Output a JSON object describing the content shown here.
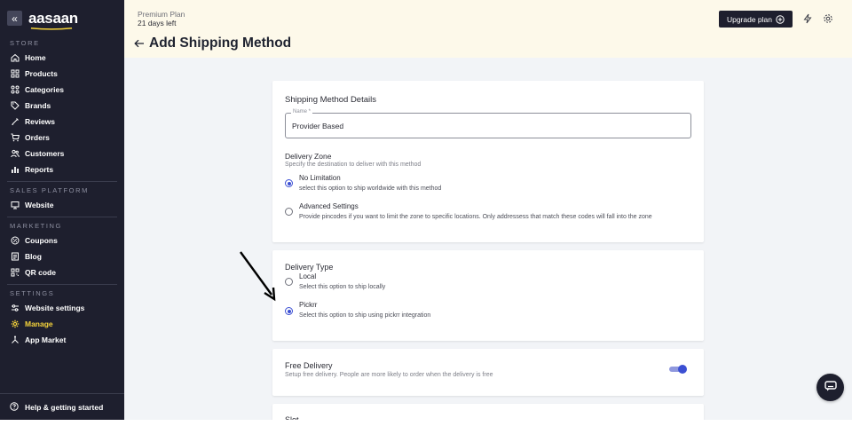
{
  "brand": {
    "logo_text": "aasaan",
    "accent_color": "#f5d33b",
    "primary_color": "#3b4fd3",
    "sidebar_bg": "#1e1f2e"
  },
  "sidebar": {
    "collapse_glyph": "«",
    "sections": [
      {
        "label": "STORE",
        "items": [
          {
            "label": "Home",
            "icon": "home-icon"
          },
          {
            "label": "Products",
            "icon": "grid-icon"
          },
          {
            "label": "Categories",
            "icon": "categories-icon"
          },
          {
            "label": "Brands",
            "icon": "tag-icon"
          },
          {
            "label": "Reviews",
            "icon": "star-pen-icon"
          },
          {
            "label": "Orders",
            "icon": "cart-icon"
          },
          {
            "label": "Customers",
            "icon": "users-icon"
          },
          {
            "label": "Reports",
            "icon": "bar-chart-icon"
          }
        ]
      },
      {
        "label": "SALES PLATFORM",
        "items": [
          {
            "label": "Website",
            "icon": "monitor-icon"
          }
        ]
      },
      {
        "label": "MARKETING",
        "items": [
          {
            "label": "Coupons",
            "icon": "coupon-icon"
          },
          {
            "label": "Blog",
            "icon": "blog-icon"
          },
          {
            "label": "QR code",
            "icon": "qr-code-icon"
          }
        ]
      },
      {
        "label": "SETTINGS",
        "items": [
          {
            "label": "Website settings",
            "icon": "sliders-icon"
          },
          {
            "label": "Manage",
            "icon": "gear-icon",
            "active": true
          },
          {
            "label": "App Market",
            "icon": "app-market-icon"
          }
        ]
      }
    ],
    "help_label": "Help & getting started"
  },
  "header": {
    "plan_name": "Premium Plan",
    "plan_days": "21 days left",
    "page_title": "Add Shipping Method",
    "upgrade_label": "Upgrade plan"
  },
  "details_card": {
    "title": "Shipping Method Details",
    "name_field": {
      "label": "Name *",
      "value": "Provider Based"
    },
    "delivery_zone": {
      "title": "Delivery Zone",
      "subtitle": "Specify the destination to deliver with this method",
      "options": [
        {
          "title": "No Limitation",
          "desc": "select this option to ship worldwide with this method",
          "selected": true
        },
        {
          "title": "Advanced Settings",
          "desc": "Provide pincodes if you want to limit the zone to specific locations. Only addressess that match these codes will fall into the zone",
          "selected": false
        }
      ]
    }
  },
  "delivery_type_card": {
    "title": "Delivery Type",
    "options": [
      {
        "title": "Local",
        "desc": "Select this option to ship locally",
        "selected": false
      },
      {
        "title": "Pickrr",
        "desc": "Select this option to ship using pickrr integration",
        "selected": true
      }
    ]
  },
  "free_delivery_card": {
    "title": "Free Delivery",
    "desc": "Setup free delivery. People are more likely to order when the delivery is free",
    "enabled": true
  },
  "next_card": {
    "title": "Slot"
  }
}
